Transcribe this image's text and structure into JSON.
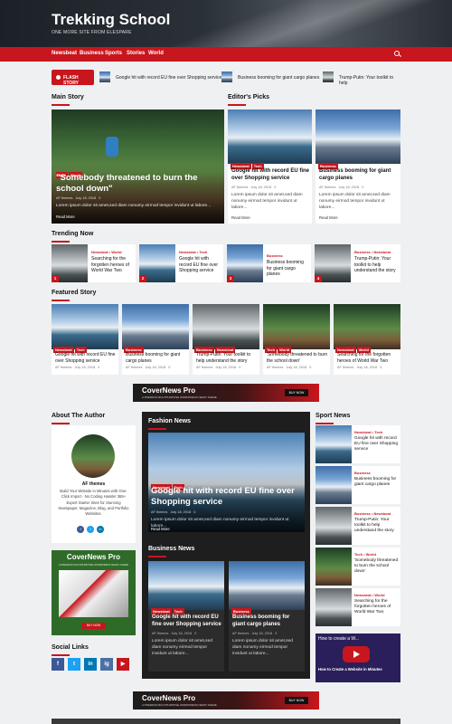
{
  "site": {
    "title": "Trekking School",
    "tagline": "ONE MORE SITE FROM ELESPARE"
  },
  "nav": {
    "items": [
      "Newsbeat",
      "Business",
      "Sports",
      "Stories",
      "World"
    ]
  },
  "flash": {
    "label": "FLASH STORY",
    "items": [
      "Google hit with record EU fine over Shopping service",
      "Business booming for giant cargo planes",
      "Trump-Putin: Your toolkit to help"
    ]
  },
  "sections": {
    "main": "Main Story",
    "editors": "Editor's Picks",
    "trending": "Trending Now",
    "featured": "Featured Story",
    "author": "About The Author",
    "fashion": "Fashion News",
    "business": "Business News",
    "sport": "Sport News",
    "social": "Social Links"
  },
  "main_story": {
    "cats": [
      "Tech",
      "World"
    ],
    "title": "\"Somebody threatened to burn the school down\"",
    "author": "AF themes",
    "date": "July 18, 2018",
    "comments": "0",
    "excerpt": "Lorem ipsum dolor sit amet,sed diam nonumy eirmod tempor invidunt ut labore...",
    "readmore": "Read More"
  },
  "editors": [
    {
      "cat": "Newsbeat",
      "cat2": "Tech",
      "title": "Google hit with record EU fine over Shopping service",
      "author": "AF themes",
      "date": "July 18, 2018",
      "comments": "0",
      "excerpt": "Lorem ipsum dolor sit amet,sed diam nonumy eirmod tempor invidunt ut labore...",
      "readmore": "Read More"
    },
    {
      "cat": "Business",
      "title": "Business booming for giant cargo planes",
      "author": "AF themes",
      "date": "July 18, 2018",
      "comments": "0",
      "excerpt": "Lorem ipsum dolor sit amet,sed diam nonumy eirmod tempor invidunt ut labore...",
      "readmore": "Read More"
    }
  ],
  "trending": [
    {
      "cats": "Newsbeat • World",
      "title": "Searching for the forgotten heroes of World War Two",
      "n": "1"
    },
    {
      "cats": "Newsbeat • Tech",
      "title": "Google hit with record EU fine over Shopping service",
      "n": "2"
    },
    {
      "cats": "Business",
      "title": "Business booming for giant cargo planes",
      "n": "3"
    },
    {
      "cats": "Business • Newsbeat",
      "title": "Trump-Putin: Your toolkit to help understand the story",
      "n": "4"
    }
  ],
  "featured": [
    {
      "cats": [
        "Newsbeat",
        "Tech"
      ],
      "title": "Google hit with record EU fine over Shopping service",
      "author": "AF themes",
      "date": "July 18, 2018",
      "comments": "0"
    },
    {
      "cats": [
        "Business"
      ],
      "title": "Business booming for giant cargo planes",
      "author": "AF themes",
      "date": "July 18, 2018",
      "comments": "0"
    },
    {
      "cats": [
        "Business",
        "Newsbeat"
      ],
      "title": "Trump-Putin: Your toolkit to help understand the story",
      "author": "AF themes",
      "date": "July 18, 2018",
      "comments": "0"
    },
    {
      "cats": [
        "Tech",
        "World"
      ],
      "title": "'Somebody threatened to burn the school down'",
      "author": "AF themes",
      "date": "July 18, 2018",
      "comments": "0"
    },
    {
      "cats": [
        "Newsbeat",
        "World"
      ],
      "title": "Searching for the forgotten heroes of World War Two",
      "author": "AF themes",
      "date": "July 18, 2018",
      "comments": "0"
    }
  ],
  "ad": {
    "title": "CoverNews Pro",
    "sub": "A PREMIUM MULTIPURPOSE WORDPRESS NEWS THEME",
    "button": "BUY NOW"
  },
  "author": {
    "name": "AF themes",
    "bio": "Build Your Website in Minutes with One-Click Import - No Coding Hassle! 365+ Expert Starter Sites for Stunning Newspaper, Magazine, Blog, and Portfolio Websites.",
    "button": "VIEW PORTFOLIO"
  },
  "sidead": {
    "title": "CoverNews Pro",
    "sub": "A PREMIUM MULTIPURPOSE WORDPRESS NEWS THEME",
    "button": "BUY NOW"
  },
  "fashion": {
    "cats": [
      "Newsbeat",
      "Tech"
    ],
    "title": "Google hit with record EU fine over Shopping service",
    "author": "AF themes",
    "date": "July 18, 2018",
    "comments": "0",
    "excerpt": "Lorem ipsum dolor sit amet,sed diam nonumy eirmod tempor invidunt ut labore...",
    "readmore": "Read More"
  },
  "business_news": [
    {
      "cats": [
        "Newsbeat",
        "Tech"
      ],
      "title": "Google hit with record EU fine over Shopping service",
      "author": "AF themes",
      "date": "July 18, 2018",
      "comments": "0",
      "excerpt": "Lorem ipsum dolor sit amet,sed diam nonumy eirmod tempor invidunt ut labore..."
    },
    {
      "cats": [
        "Business"
      ],
      "title": "Business booming for giant cargo planes",
      "author": "AF themes",
      "date": "July 18, 2018",
      "comments": "0",
      "excerpt": "Lorem ipsum dolor sit amet,sed diam nonumy eirmod tempor invidunt ut labore..."
    }
  ],
  "sport": [
    {
      "cats": "Newsbeat • Tech",
      "title": "Google hit with record EU fine over Shopping service"
    },
    {
      "cats": "Business",
      "title": "Business booming for giant cargo planes"
    },
    {
      "cats": "Business • Newsbeat",
      "title": "Trump-Putin: Your toolkit to help understand the story"
    },
    {
      "cats": "Tech • World",
      "title": "'Somebody threatened to burn the school down'"
    },
    {
      "cats": "Newsbeat • World",
      "title": "Searching for the forgotten heroes of World War Two"
    }
  ],
  "video": {
    "title": "How to create a W...",
    "caption": "How to Create a Website in Minutes"
  },
  "social": [
    "f",
    "t",
    "in",
    "ig",
    "▶"
  ],
  "colors": {
    "accent": "#c7161d",
    "dark": "#1e1e1e"
  }
}
